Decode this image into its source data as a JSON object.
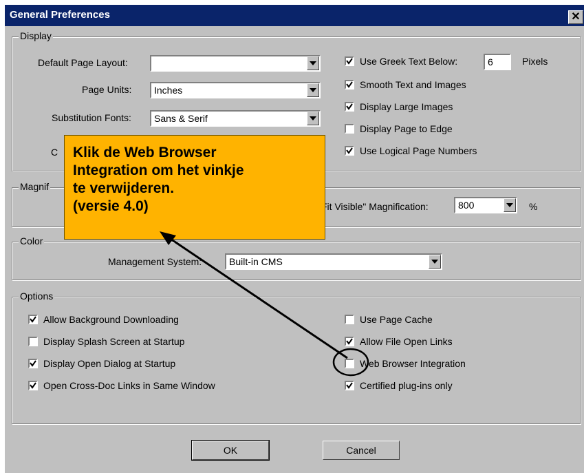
{
  "window": {
    "title": "General Preferences",
    "close_glyph": "✕"
  },
  "display": {
    "legend": "Display",
    "default_page_layout_label": "Default Page Layout:",
    "default_page_layout_value": "",
    "page_units_label": "Page Units:",
    "page_units_value": "Inches",
    "substitution_fonts_label": "Substitution Fonts:",
    "substitution_fonts_value": "Sans & Serif",
    "hidden_label_fragment": "C",
    "greek_text_label": "Use Greek Text Below:",
    "greek_text_value": "6",
    "greek_text_unit": "Pixels",
    "checkboxes": [
      {
        "label": "Use Greek Text Below:",
        "checked": true
      },
      {
        "label": "Smooth Text and Images",
        "checked": true
      },
      {
        "label": "Display Large Images",
        "checked": true
      },
      {
        "label": "Display Page to Edge",
        "checked": false
      },
      {
        "label": "Use Logical Page Numbers",
        "checked": true
      }
    ]
  },
  "magnification": {
    "legend": "Magnif",
    "label": "Fit Visible\" Magnification:",
    "value": "800",
    "unit": "%"
  },
  "color": {
    "legend": "Color",
    "management_label": "Management System:",
    "management_value": "Built-in CMS"
  },
  "options": {
    "legend": "Options",
    "left": [
      {
        "label": "Allow Background Downloading",
        "checked": true
      },
      {
        "label": "Display Splash Screen at Startup",
        "checked": false
      },
      {
        "label": "Display Open Dialog at Startup",
        "checked": true
      },
      {
        "label": "Open Cross-Doc Links in Same Window",
        "checked": true
      }
    ],
    "right": [
      {
        "label": "Use Page Cache",
        "checked": false
      },
      {
        "label": "Allow File Open Links",
        "checked": true
      },
      {
        "label": "Web Browser Integration",
        "checked": false
      },
      {
        "label": "Certified plug-ins only",
        "checked": true
      }
    ]
  },
  "buttons": {
    "ok": "OK",
    "cancel": "Cancel"
  },
  "callout": {
    "lines": [
      "Klik de Web Browser",
      "Integration om het vinkje",
      "te verwijderen.",
      "(versie 4.0)"
    ]
  },
  "colors": {
    "titlebar": "#0a246a",
    "dialog": "#c0c0c0",
    "callout": "#ffb300"
  }
}
